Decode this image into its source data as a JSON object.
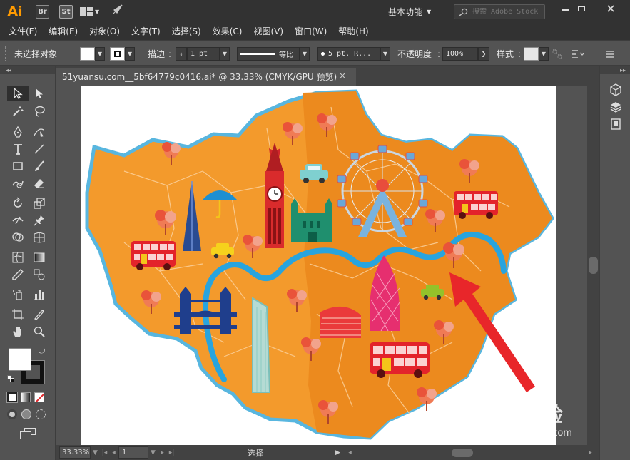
{
  "app": {
    "logo_text": "Ai",
    "badge_br": "Br",
    "badge_st": "St",
    "workspace_label": "基本功能",
    "search_placeholder": "搜索 Adobe Stock"
  },
  "menu": {
    "items": [
      "文件(F)",
      "编辑(E)",
      "对象(O)",
      "文字(T)",
      "选择(S)",
      "效果(C)",
      "视图(V)",
      "窗口(W)",
      "帮助(H)"
    ]
  },
  "control_bar": {
    "selection_status": "未选择对象",
    "stroke_label": "描边",
    "stroke_weight": "1 pt",
    "stroke_profile": "等比",
    "brush": "5 pt. R...",
    "opacity_label": "不透明度",
    "opacity_value": "100%",
    "style_label": "样式"
  },
  "document": {
    "tab_title": "51yuansu.com__5bf64779c0416.ai* @ 33.33% (CMYK/GPU 预览)",
    "close_glyph": "×"
  },
  "status_bar": {
    "zoom": "33.33%",
    "artboard_number": "1",
    "tool_status": "选择"
  },
  "watermark": {
    "main": "Bai 经验",
    "sub": "jingyan.baidu.com"
  },
  "colors": {
    "app_bg": "#535353",
    "bar_bg": "#323232",
    "accent_ai": "#ff9a00",
    "map_orange": "#f39a2c",
    "map_orange_dark": "#e8891d",
    "river_blue": "#2aa6df",
    "arrow_red": "#e8262a"
  }
}
